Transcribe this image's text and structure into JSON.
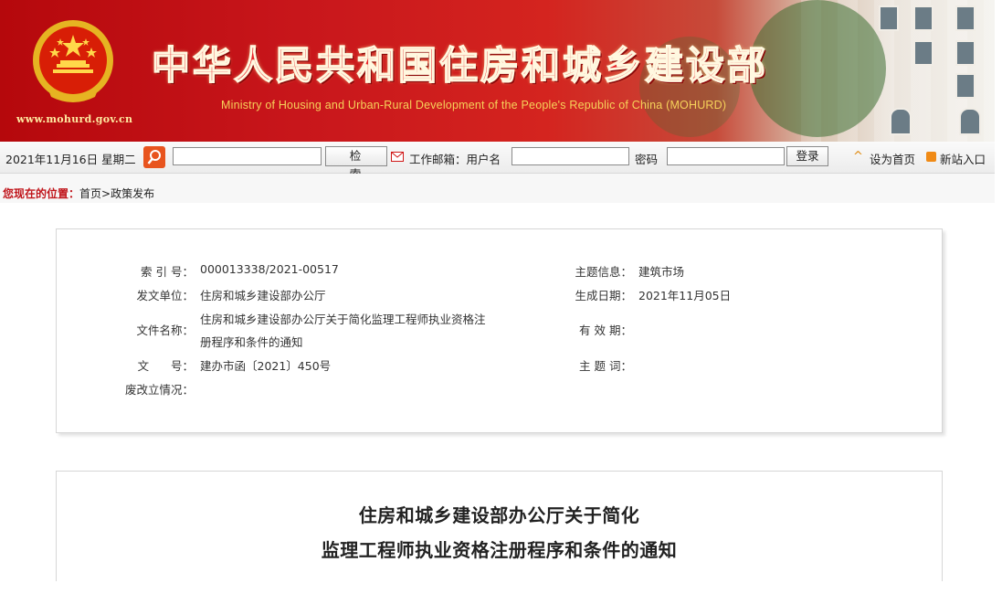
{
  "header": {
    "title_cn": "中华人民共和国住房和城乡建设部",
    "title_en": "Ministry of Housing and Urban-Rural Development of the People's Republic of China (MOHURD)",
    "site_url": "www.mohurd.gov.cn"
  },
  "toolbar": {
    "date": "2021年11月16日 星期二",
    "search_value": "",
    "search_button": "检 索",
    "mail_label": "工作邮箱：用户名",
    "username_value": "",
    "password_label": "密码",
    "password_value": "",
    "login_button": "登录",
    "set_home": "设为首页",
    "new_site": "新站入口"
  },
  "breadcrumb": {
    "here": "您现在的位置：",
    "path": "首页>政策发布"
  },
  "info": {
    "index_label": "索 引 号：",
    "index_value": "000013338/2021-00517",
    "issuer_label": "发文单位：",
    "issuer_value": "住房和城乡建设部办公厅",
    "filename_label": "文件名称：",
    "filename_line1": "住房和城乡建设部办公厅关于简化监理工程师执业资格注",
    "filename_line2": "册程序和条件的通知",
    "docno_label": "文      号：",
    "docno_value": "建办市函〔2021〕450号",
    "status_label": "废改立情况：",
    "status_value": "",
    "topic_label": "主题信息：",
    "topic_value": "建筑市场",
    "date_label": "生成日期：",
    "date_value": "2021年11月05日",
    "validity_label": "有 效 期：",
    "validity_value": "",
    "keywords_label": "主 题 词：",
    "keywords_value": ""
  },
  "article": {
    "title_line1": "住房和城乡建设部办公厅关于简化",
    "title_line2": "监理工程师执业资格注册程序和条件的通知"
  }
}
